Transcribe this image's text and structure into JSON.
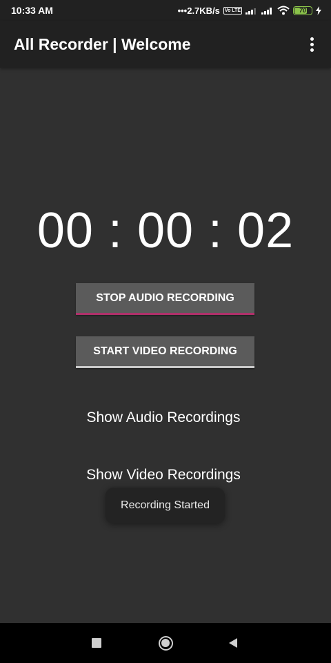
{
  "status_bar": {
    "time": "10:33 AM",
    "net_speed": "2.7KB/s",
    "volte_label": "Vo LTE",
    "battery_level": "70",
    "battery_fraction": 0.7,
    "battery_color": "#8bc34a"
  },
  "app_bar": {
    "title": "All Recorder | Welcome",
    "menu_icon": "more-vert-icon"
  },
  "timer": {
    "value": "00 : 00 : 02"
  },
  "buttons": {
    "stop_audio": "STOP AUDIO RECORDING",
    "start_video": "START VIDEO RECORDING",
    "stop_audio_accent": "#b0306a"
  },
  "links": {
    "show_audio": "Show Audio Recordings",
    "show_video": "Show Video Recordings"
  },
  "toast": {
    "message": "Recording Started"
  },
  "nav_bar": {
    "recent_icon": "recent-apps-icon",
    "home_icon": "home-icon",
    "back_icon": "back-icon"
  }
}
